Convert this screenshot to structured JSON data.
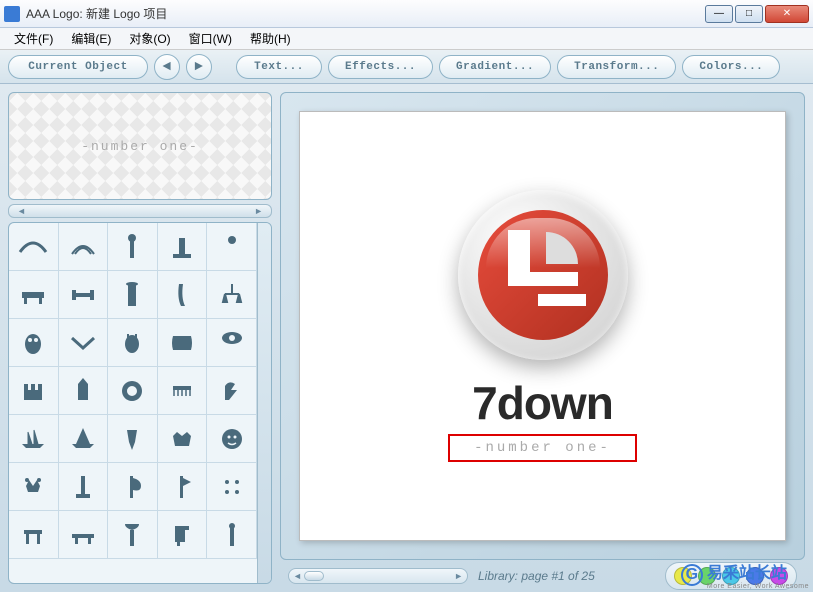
{
  "window": {
    "title": "AAA Logo: 新建 Logo 项目"
  },
  "menu": {
    "file": "文件(F)",
    "edit": "编辑(E)",
    "object": "对象(O)",
    "window": "窗口(W)",
    "help": "帮助(H)"
  },
  "toolbar": {
    "current_object": "Current Object",
    "prev": "◄",
    "next": "►",
    "text": "Text...",
    "effects": "Effects...",
    "gradient": "Gradient...",
    "transform": "Transform...",
    "colors": "Colors..."
  },
  "preview": {
    "text": "-number one-"
  },
  "library": {
    "nav_left": "◄",
    "nav_right": "►",
    "page_info": "Library: page #1 of 25",
    "items": [
      "arc",
      "rainbow",
      "staff",
      "stand",
      "figure",
      "bench",
      "dumbbell",
      "pillar",
      "leg",
      "scale",
      "owl",
      "chevron",
      "owl2",
      "scroll",
      "horus",
      "castle",
      "tower",
      "disc",
      "comb",
      "falcon",
      "ship1",
      "ship2",
      "goblet",
      "crown",
      "face",
      "crown2",
      "post",
      "axe",
      "axe2",
      "dots",
      "table",
      "bench2",
      "lamp",
      "chair",
      "pole"
    ]
  },
  "canvas": {
    "logo_text": "7down",
    "logo_subtitle": "-number one-"
  },
  "colors": {
    "dots": [
      "#e8e84a",
      "#6ad46a",
      "#4ac8e8",
      "#4a7ae8",
      "#c84ae8"
    ]
  },
  "scroll": {
    "left": "◄",
    "right": "►"
  },
  "watermark": {
    "text": "易采站长站",
    "sub": "More Easier, Work Awesome"
  }
}
